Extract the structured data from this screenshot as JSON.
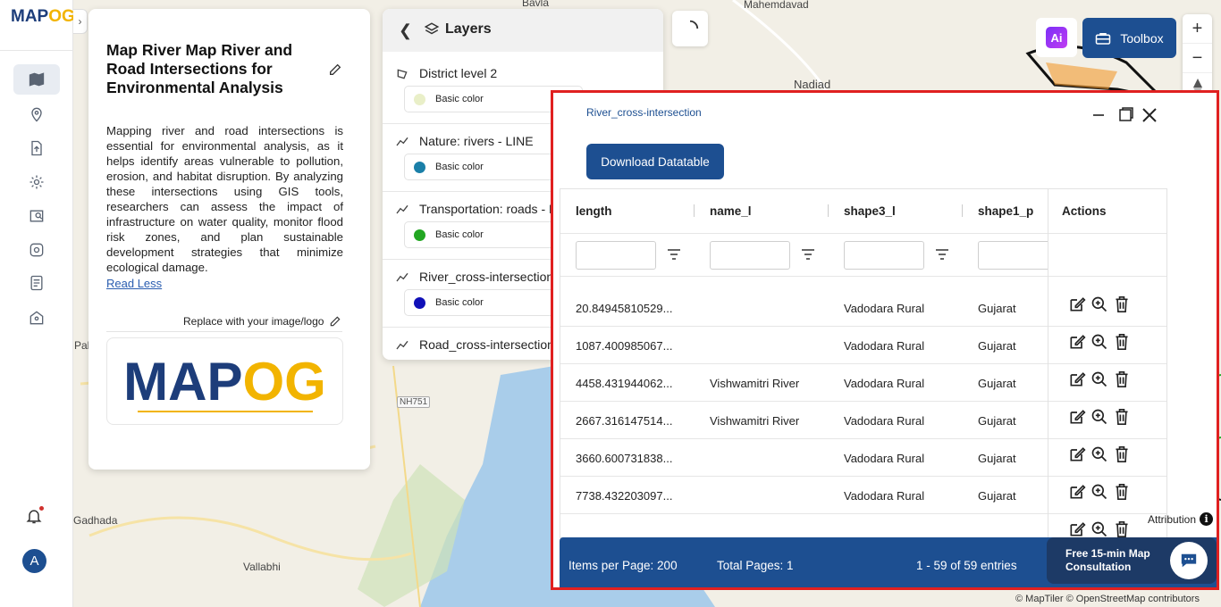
{
  "app": {
    "logo": {
      "left": "MAP",
      "right": "OG"
    },
    "rail_toggle": "›",
    "avatar_letter": "A"
  },
  "map": {
    "labels": [
      "Bavla",
      "Mahemdavad",
      "Nadiad",
      "Pali",
      "Gadhada",
      "Vallabhi"
    ],
    "road_badge": "NH751",
    "colors": {
      "land": "#f2efe6",
      "water": "#a9cdea",
      "green": "#cfe3b8"
    }
  },
  "description": {
    "title": "Map River Map River and Road Intersections for Environmental Analysis",
    "body": "Mapping river and road intersections is essential for environmental analysis, as it helps identify areas vulnerable to pollution, erosion, and habitat disruption. By analyzing these intersections using GIS tools, researchers can assess the impact of infrastructure on water quality, monitor flood risk zones, and plan sustainable development strategies that minimize ecological damage.",
    "read_less": "Read Less",
    "replace_label": "Replace with your image/logo",
    "logo": {
      "left": "MAP",
      "right": "OG"
    }
  },
  "layers": {
    "title": "Layers",
    "items": [
      {
        "name": "District level 2",
        "color_label": "Basic color",
        "swatch": "#e9efc8"
      },
      {
        "name": "Nature: rivers - LINE",
        "color_label": "Basic color",
        "swatch": "#1a7fa8"
      },
      {
        "name": "Transportation: roads - L",
        "color_label": "Basic color",
        "swatch": "#22a622"
      },
      {
        "name": "River_cross-intersection",
        "color_label": "Basic color",
        "swatch": "#1010b8"
      },
      {
        "name": "Road_cross-intersection",
        "color_label": "",
        "swatch": ""
      }
    ]
  },
  "toolbar": {
    "ai_label": "Ai",
    "toolbox_label": "Toolbox",
    "zoom_in": "+",
    "zoom_out": "−"
  },
  "datatable": {
    "title": "River_cross-intersection",
    "download_label": "Download Datatable",
    "columns": [
      "length",
      "name_l",
      "shape3_l",
      "shape1_p",
      "Actions"
    ],
    "rows": [
      [
        "20.84945810529...",
        "",
        "Vadodara Rural",
        "Gujarat"
      ],
      [
        "1087.400985067...",
        "",
        "Vadodara Rural",
        "Gujarat"
      ],
      [
        "4458.431944062...",
        "Vishwamitri River",
        "Vadodara Rural",
        "Gujarat"
      ],
      [
        "2667.316147514...",
        "Vishwamitri River",
        "Vadodara Rural",
        "Gujarat"
      ],
      [
        "3660.600731838...",
        "",
        "Vadodara Rural",
        "Gujarat"
      ],
      [
        "7738.432203097...",
        "",
        "Vadodara Rural",
        "Gujarat"
      ]
    ],
    "pager": {
      "items_per_page": "Items per Page: 200",
      "total_pages": "Total Pages: 1",
      "entries": "1 - 59 of 59 entries"
    }
  },
  "chat": {
    "line1": "Free 15-min Map",
    "line2": "Consultation"
  },
  "attribution": {
    "label": "Attribution",
    "copyright": "© MapTiler © OpenStreetMap contributors"
  }
}
